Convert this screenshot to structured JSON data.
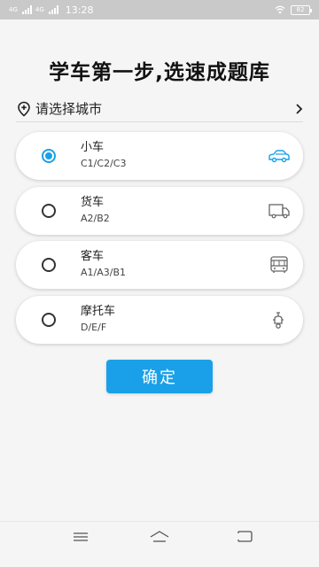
{
  "status_bar": {
    "net1": "4G",
    "net2": "4G",
    "time": "13:28",
    "battery": "82"
  },
  "header": {
    "title": "学车第一步,选速成题库"
  },
  "city": {
    "label": "请选择城市",
    "icon": "location-plus-icon",
    "chevron": "chevron-right-icon"
  },
  "options": [
    {
      "name": "小车",
      "sub": "C1/C2/C3",
      "icon": "car-icon",
      "checked": true
    },
    {
      "name": "货车",
      "sub": "A2/B2",
      "icon": "truck-icon",
      "checked": false
    },
    {
      "name": "客车",
      "sub": "A1/A3/B1",
      "icon": "bus-icon",
      "checked": false
    },
    {
      "name": "摩托车",
      "sub": "D/E/F",
      "icon": "scooter-icon",
      "checked": false
    }
  ],
  "confirm": {
    "label": "确定"
  },
  "colors": {
    "accent": "#1aa0e8",
    "background": "#f5f5f5",
    "card": "#ffffff"
  },
  "nav": {
    "menu_icon": "menu-icon",
    "home_icon": "home-icon",
    "back_icon": "back-icon"
  }
}
